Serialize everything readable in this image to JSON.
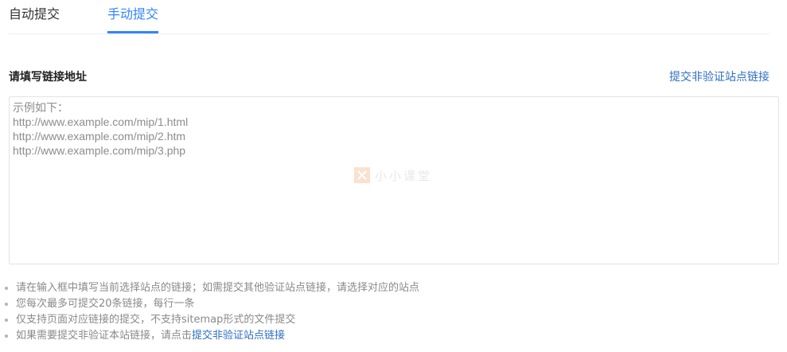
{
  "tabs": {
    "auto_label": "自动提交",
    "manual_label": "手动提交"
  },
  "form": {
    "title": "请填写链接地址",
    "top_link": "提交非验证站点链接",
    "textarea_placeholder": "示例如下：\nhttp://www.example.com/mip/1.html\nhttp://www.example.com/mip/2.htm\nhttp://www.example.com/mip/3.php"
  },
  "watermark": {
    "text": "小小课堂"
  },
  "tips": {
    "tip1": "请在输入框中填写当前选择站点的链接；如需提交其他验证站点链接，请选择对应的站点",
    "tip2": "您每次最多可提交20条链接，每行一条",
    "tip3": "仅支持页面对应链接的提交，不支持sitemap形式的文件提交",
    "tip4_prefix": "如果需要提交非验证本站链接，请点击",
    "tip4_link": "提交非验证站点链接"
  },
  "colors": {
    "accent": "#3385ff",
    "link": "#2f6ec6",
    "muted": "#8a8a8a",
    "border": "#e3e3e3"
  }
}
